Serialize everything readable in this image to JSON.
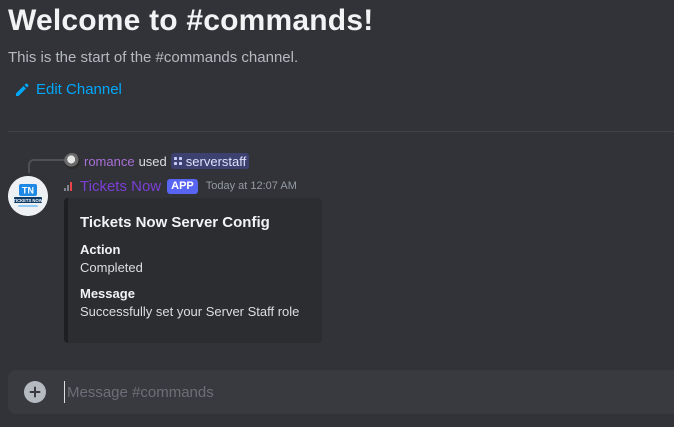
{
  "welcome": {
    "title": "Welcome to #commands!",
    "subtitle": "This is the start of the #commands channel."
  },
  "edit_channel": {
    "label": "Edit Channel",
    "icon": "pencil-icon"
  },
  "command_usage": {
    "user": "romance",
    "used_text": "used",
    "command": "serverstaff",
    "command_icon": "slash-command-icon"
  },
  "message": {
    "author": "Tickets Now",
    "badge": "APP",
    "timestamp": "Today at 12:07 AM",
    "avatar_text": "TICKETS NOW"
  },
  "embed": {
    "title": "Tickets Now Server Config",
    "fields": [
      {
        "name": "Action",
        "value": "Completed"
      },
      {
        "name": "Message",
        "value": "Successfully set your Server Staff role"
      }
    ]
  },
  "composer": {
    "placeholder": "Message #commands",
    "value": ""
  },
  "colors": {
    "background": "#313338",
    "link": "#00a8fc",
    "bot_name": "#7b3fd6",
    "user_name": "#a970d6",
    "app_badge": "#5865f2"
  }
}
